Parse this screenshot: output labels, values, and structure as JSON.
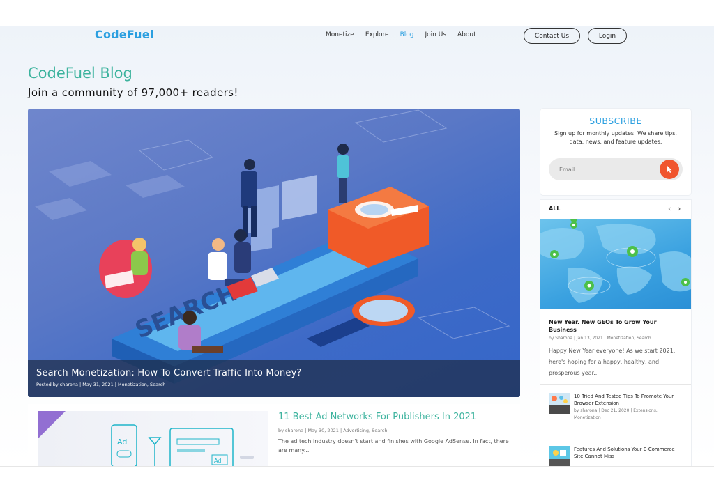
{
  "header": {
    "logo": "CodeFuel",
    "nav": [
      "Monetize",
      "Explore",
      "Blog",
      "Join Us",
      "About"
    ],
    "active_nav": "Blog",
    "contact_label": "Contact Us",
    "login_label": "Login"
  },
  "page": {
    "title": "CodeFuel Blog",
    "subtitle": "Join a community of 97,000+ readers!"
  },
  "hero": {
    "title": "Search Monetization: How To Convert Traffic Into Money?",
    "meta": "Posted by sharona | May 31, 2021 | Monetization, Search",
    "image_word": "SEARCH"
  },
  "article2": {
    "title": "11 Best Ad Networks For Publishers In 2021",
    "meta": "by sharona | May 30, 2021 | Advertising, Search",
    "excerpt": "The ad tech industry doesn't start and finishes with Google AdSense. In fact, there are many...",
    "image_badges": [
      "Ad",
      "Ad"
    ]
  },
  "subscribe": {
    "title": "SUBSCRIBE",
    "description": "Sign up for monthly updates. We share tips, data, news, and feature updates.",
    "email_placeholder": "Email",
    "submit_icon": "cursor-arrow-icon"
  },
  "sidebar": {
    "tab": "ALL",
    "featured": {
      "title": "New Year. New GEOs To Grow Your Business",
      "meta": "by Sharona | Jan 13, 2021 | Monetization, Search",
      "excerpt": "Happy New Year everyone! As we start 2021, here's hoping for a happy, healthy, and prosperous year..."
    },
    "posts": [
      {
        "title": "10 Tried And Tested Tips To Promote Your Browser Extension",
        "meta": "by sharona | Dec 21, 2020 | Extensions, Monetization"
      },
      {
        "title": "Features And Solutions Your E-Commerce Site Cannot Miss",
        "meta": ""
      }
    ]
  },
  "colors": {
    "brand_blue": "#2b9fe0",
    "title_green": "#3db39e",
    "cta_orange": "#f0552e"
  }
}
